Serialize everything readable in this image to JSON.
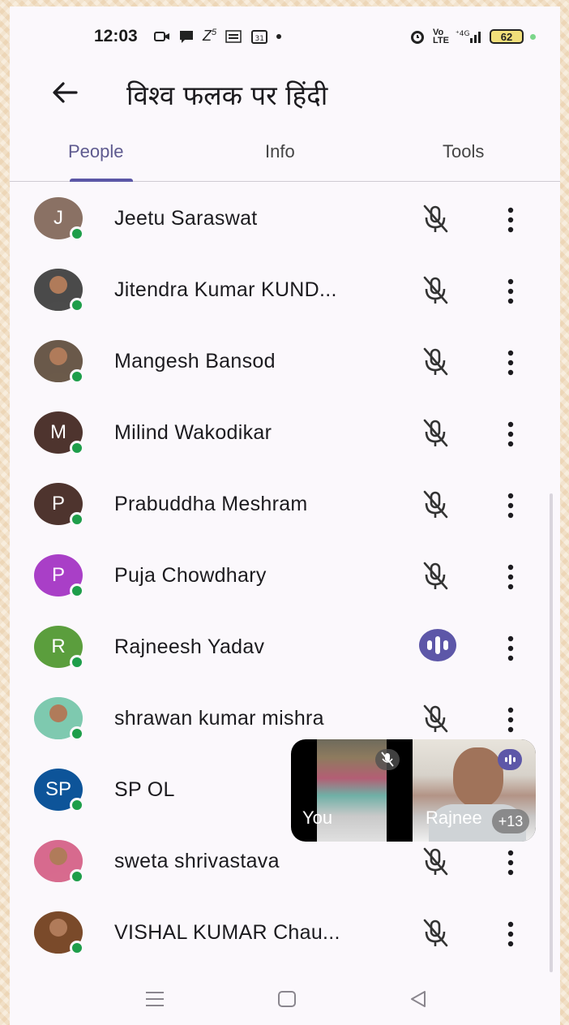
{
  "status_bar": {
    "time": "12:03",
    "battery": "62"
  },
  "header": {
    "title": "विश्व फलक पर हिंदी",
    "back_icon": "arrow-left-icon"
  },
  "tabs": [
    {
      "label": "People",
      "active": true
    },
    {
      "label": "Info",
      "active": false
    },
    {
      "label": "Tools",
      "active": false
    }
  ],
  "participants": [
    {
      "name": "Jeetu Saraswat",
      "initial": "J",
      "avatar_color": "#8a7164",
      "photo": false,
      "state": "muted"
    },
    {
      "name": "Jitendra Kumar KUND...",
      "initial": "",
      "avatar_color": "#4b4b4b",
      "photo": true,
      "state": "muted"
    },
    {
      "name": "Mangesh Bansod",
      "initial": "",
      "avatar_color": "#6b5a4a",
      "photo": true,
      "state": "muted"
    },
    {
      "name": "Milind Wakodikar",
      "initial": "M",
      "avatar_color": "#4e342e",
      "photo": false,
      "state": "muted"
    },
    {
      "name": "Prabuddha Meshram",
      "initial": "P",
      "avatar_color": "#4e342e",
      "photo": false,
      "state": "muted"
    },
    {
      "name": "Puja Chowdhary",
      "initial": "P",
      "avatar_color": "#a93fc7",
      "photo": false,
      "state": "muted"
    },
    {
      "name": "Rajneesh Yadav",
      "initial": "R",
      "avatar_color": "#5b9e3d",
      "photo": false,
      "state": "speaking"
    },
    {
      "name": "shrawan kumar mishra",
      "initial": "",
      "avatar_color": "#7fc9b0",
      "photo": true,
      "state": "muted"
    },
    {
      "name": "SP OL",
      "initial": "SP",
      "avatar_color": "#0d5499",
      "photo": false,
      "state": "hidden"
    },
    {
      "name": "sweta shrivastava",
      "initial": "",
      "avatar_color": "#d76b8e",
      "photo": true,
      "state": "muted"
    },
    {
      "name": "VISHAL KUMAR Chau...",
      "initial": "",
      "avatar_color": "#7a4a2a",
      "photo": true,
      "state": "muted"
    }
  ],
  "pip": {
    "self_label": "You",
    "other_label": "Rajnee",
    "more_count": "+13"
  },
  "colors": {
    "accent": "#5b57a6",
    "online": "#1e9e4a",
    "background": "#fbf8fc"
  }
}
